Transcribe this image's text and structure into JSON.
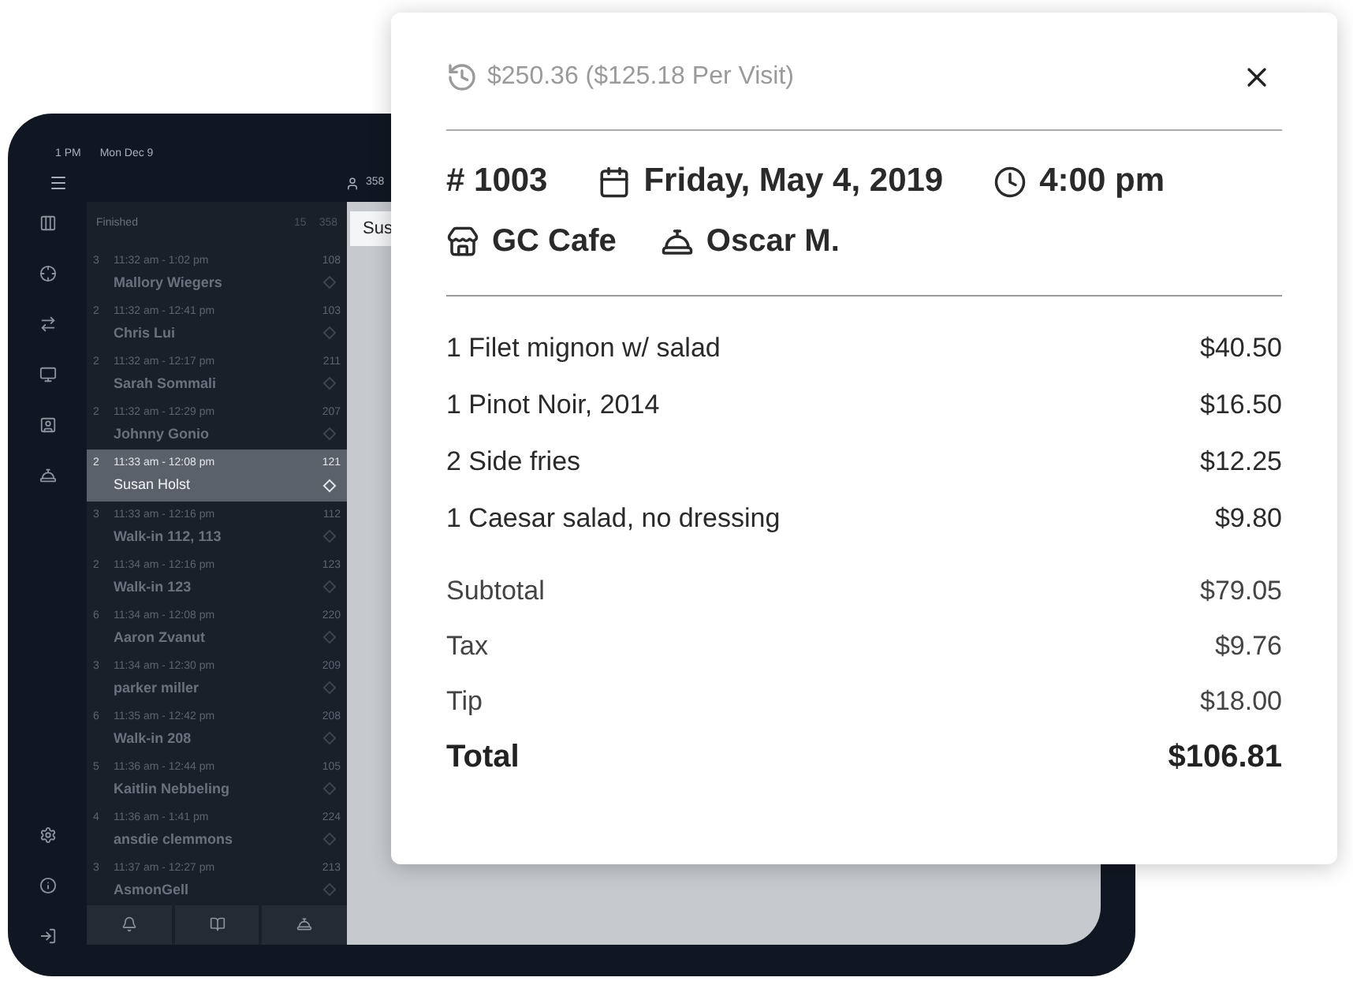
{
  "tablet": {
    "status_time": "1 PM",
    "status_date": "Mon Dec 9",
    "user_count": "358",
    "list_header": {
      "title": "Finished",
      "count_a": "15",
      "count_b": "358"
    },
    "rows": [
      {
        "party": "3",
        "time": "11:32 am - 1:02 pm",
        "name": "Mallory Wiegers",
        "table": "108",
        "selected": false
      },
      {
        "party": "2",
        "time": "11:32 am - 12:41 pm",
        "name": "Chris Lui",
        "table": "103",
        "selected": false
      },
      {
        "party": "2",
        "time": "11:32 am - 12:17 pm",
        "name": "Sarah Sommali",
        "table": "211",
        "selected": false
      },
      {
        "party": "2",
        "time": "11:32 am - 12:29 pm",
        "name": "Johnny Gonio",
        "table": "207",
        "selected": false
      },
      {
        "party": "2",
        "time": "11:33 am - 12:08 pm",
        "name": "Susan Holst",
        "table": "121",
        "selected": true
      },
      {
        "party": "3",
        "time": "11:33 am - 12:16 pm",
        "name": "Walk-in 112, 113",
        "table": "112",
        "selected": false
      },
      {
        "party": "2",
        "time": "11:34 am - 12:16 pm",
        "name": "Walk-in 123",
        "table": "123",
        "selected": false
      },
      {
        "party": "6",
        "time": "11:34 am - 12:08 pm",
        "name": "Aaron Zvanut",
        "table": "220",
        "selected": false
      },
      {
        "party": "3",
        "time": "11:34 am - 12:30 pm",
        "name": "parker miller",
        "table": "209",
        "selected": false
      },
      {
        "party": "6",
        "time": "11:35 am - 12:42 pm",
        "name": "Walk-in 208",
        "table": "208",
        "selected": false
      },
      {
        "party": "5",
        "time": "11:36 am - 12:44 pm",
        "name": "Kaitlin Nebbeling",
        "table": "105",
        "selected": false
      },
      {
        "party": "4",
        "time": "11:36 am - 1:41 pm",
        "name": "ansdie clemmons",
        "table": "224",
        "selected": false
      },
      {
        "party": "3",
        "time": "11:37 am - 12:27 pm",
        "name": "AsmonGell",
        "table": "213",
        "selected": false
      }
    ],
    "detail_title": "Sus"
  },
  "receipt": {
    "history": "$250.36 ($125.18 Per Visit)",
    "check_number": "# 1003",
    "date": "Friday, May 4, 2019",
    "time": "4:00 pm",
    "location": "GC Cafe",
    "server": "Oscar M.",
    "items": [
      {
        "name": "1 Filet mignon w/ salad",
        "price": "$40.50"
      },
      {
        "name": "1 Pinot Noir, 2014",
        "price": "$16.50"
      },
      {
        "name": "2 Side fries",
        "price": "$12.25"
      },
      {
        "name": "1 Caesar salad, no dressing",
        "price": "$9.80"
      }
    ],
    "totals": [
      {
        "kind": "line",
        "label": "Subtotal",
        "value": "$79.05"
      },
      {
        "kind": "line",
        "label": "Tax",
        "value": "$9.76"
      },
      {
        "kind": "line",
        "label": "Tip",
        "value": "$18.00"
      },
      {
        "kind": "total",
        "label": "Total",
        "value": "$106.81"
      }
    ]
  }
}
